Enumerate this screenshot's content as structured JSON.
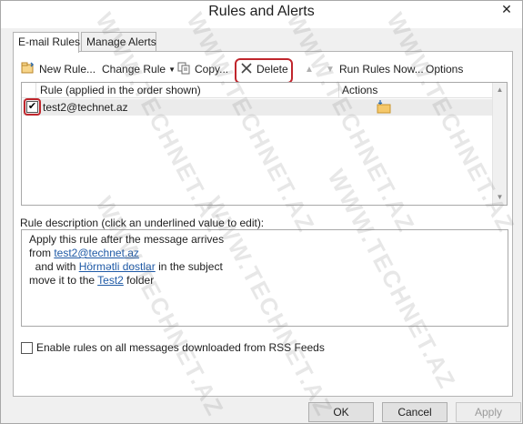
{
  "window": {
    "title": "Rules and Alerts",
    "close_glyph": "✕"
  },
  "tabs": [
    {
      "label": "E-mail Rules",
      "active": true
    },
    {
      "label": "Manage Alerts",
      "active": false
    }
  ],
  "toolbar": {
    "new_rule": "New Rule...",
    "change_rule": "Change Rule",
    "copy": "Copy...",
    "delete": "Delete",
    "run_rules_now": "Run Rules Now...",
    "options": "Options"
  },
  "rules_list": {
    "columns": [
      "Rule (applied in the order shown)",
      "Actions"
    ],
    "rows": [
      {
        "name": "test2@technet.az",
        "checked": true,
        "action_icon": "move-to-folder-icon"
      }
    ]
  },
  "description": {
    "label": "Rule description (click an underlined value to edit):",
    "line1": "Apply this rule after the message arrives",
    "line2_prefix": "from ",
    "line2_link": "test2@technet.az",
    "line3_prefix": "  and with ",
    "line3_link": "Hörmətli dostlar",
    "line3_suffix": " in the subject",
    "line4_prefix": "move it to the ",
    "line4_link": "Test2",
    "line4_suffix": " folder"
  },
  "rss_checkbox": {
    "label": "Enable rules on all messages downloaded from RSS Feeds",
    "checked": false
  },
  "buttons": {
    "ok": "OK",
    "cancel": "Cancel",
    "apply": "Apply"
  },
  "watermark_text": "WWW.TECHNET.AZ",
  "colors": {
    "highlight": "#c0262d",
    "link": "#1f5aa6"
  }
}
